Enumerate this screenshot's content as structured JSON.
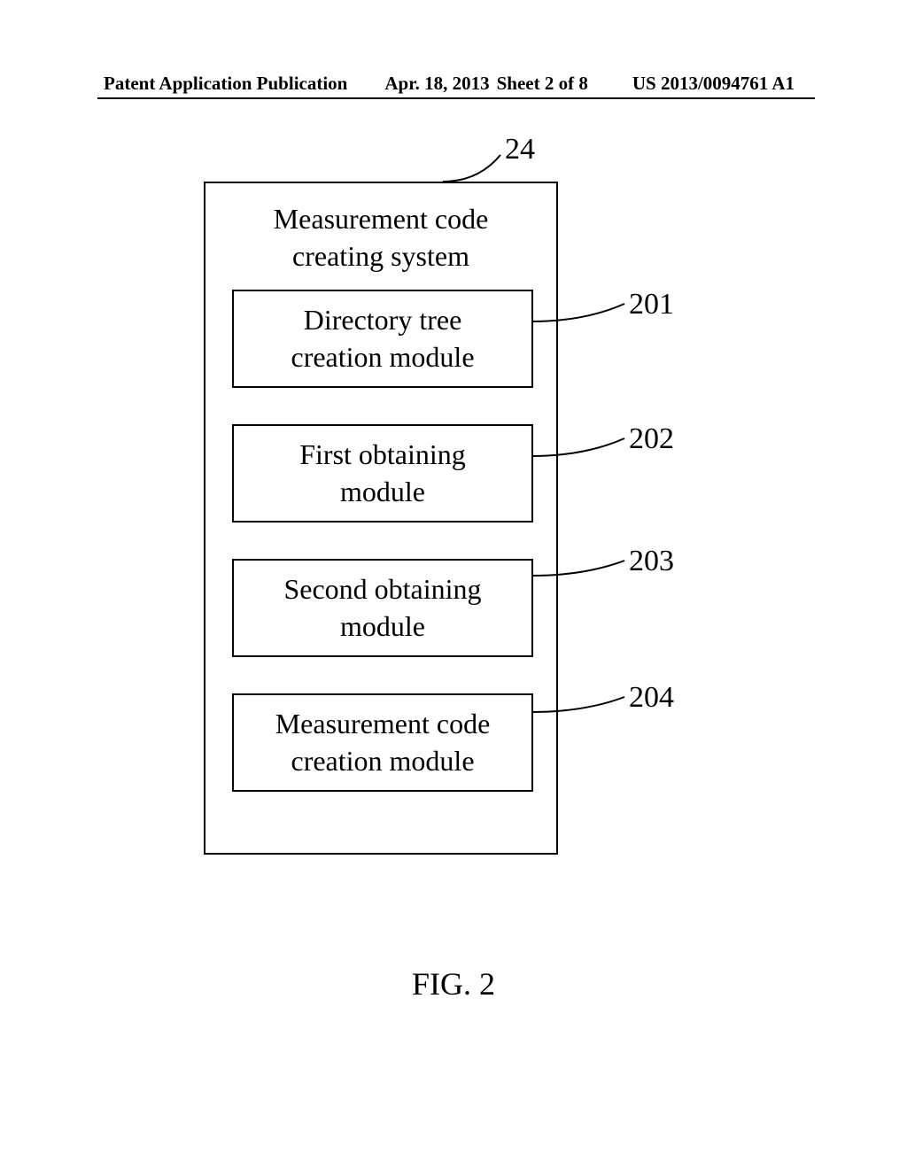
{
  "header": {
    "pub_type": "Patent Application Publication",
    "date": "Apr. 18, 2013",
    "sheet": "Sheet 2 of 8",
    "pub_num": "US 2013/0094761 A1"
  },
  "figure": {
    "main_ref": "24",
    "system_title_l1": "Measurement code",
    "system_title_l2": "creating system",
    "modules": [
      {
        "ref": "201",
        "l1": "Directory tree",
        "l2": "creation module"
      },
      {
        "ref": "202",
        "l1": "First obtaining",
        "l2": "module"
      },
      {
        "ref": "203",
        "l1": "Second obtaining",
        "l2": "module"
      },
      {
        "ref": "204",
        "l1": "Measurement code",
        "l2": "creation module"
      }
    ],
    "caption": "FIG. 2"
  }
}
